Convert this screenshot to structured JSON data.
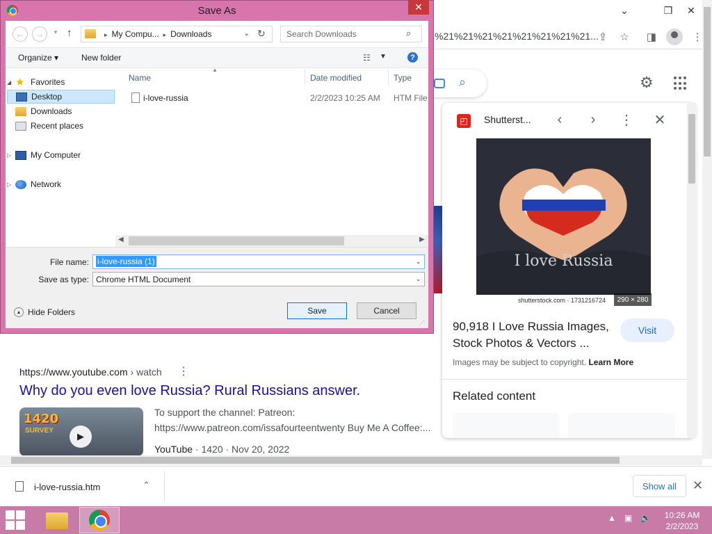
{
  "chrome": {
    "url_tail": "%21%21%21%21%21%21%21%21...",
    "window_controls": {
      "minimize": "⌄",
      "restore": "❐",
      "close": "✕"
    }
  },
  "search_page": {
    "panel": {
      "source": "Shutterst...",
      "image_text": "I love Russia",
      "credit": "shutterstock.com · 1731216724",
      "size": "290 × 280",
      "title": "90,918 I Love Russia Images, Stock Photos & Vectors ...",
      "visit": "Visit",
      "copyright": "Images may be subject to copyright.",
      "learn_more": "Learn More",
      "related": "Related content"
    },
    "result": {
      "url": "https://www.youtube.com",
      "crumb": " › watch",
      "title": "Why do you even love Russia? Rural Russians answer.",
      "thumb_label": "1420",
      "thumb_label2": "SURVEY",
      "desc": "To support the channel: Patreon: https://www.patreon.com/issafourteentwenty Buy Me A Coffee:...",
      "meta_source": "YouTube",
      "meta_rest": " · 1420 · Nov 20, 2022"
    }
  },
  "download_bar": {
    "file": "i-love-russia.htm",
    "show_all": "Show all"
  },
  "taskbar": {
    "time": "10:26 AM",
    "date": "2/2/2023"
  },
  "dialog": {
    "title": "Save As",
    "address": {
      "root": "My Compu...",
      "folder": "Downloads"
    },
    "search_placeholder": "Search Downloads",
    "organize": "Organize ▾",
    "new_folder": "New folder",
    "nav": {
      "favorites": "Favorites",
      "desktop": "Desktop",
      "downloads": "Downloads",
      "recent": "Recent places",
      "computer": "My Computer",
      "network": "Network"
    },
    "columns": {
      "name": "Name",
      "date": "Date modified",
      "type": "Type"
    },
    "file": {
      "name": "i-love-russia",
      "date": "2/2/2023 10:25 AM",
      "type": "HTM File"
    },
    "file_name_label": "File name:",
    "file_name_value": "i-love-russia (1)",
    "save_type_label": "Save as type:",
    "save_type_value": "Chrome HTML Document",
    "hide_folders": "Hide Folders",
    "save": "Save",
    "cancel": "Cancel"
  }
}
